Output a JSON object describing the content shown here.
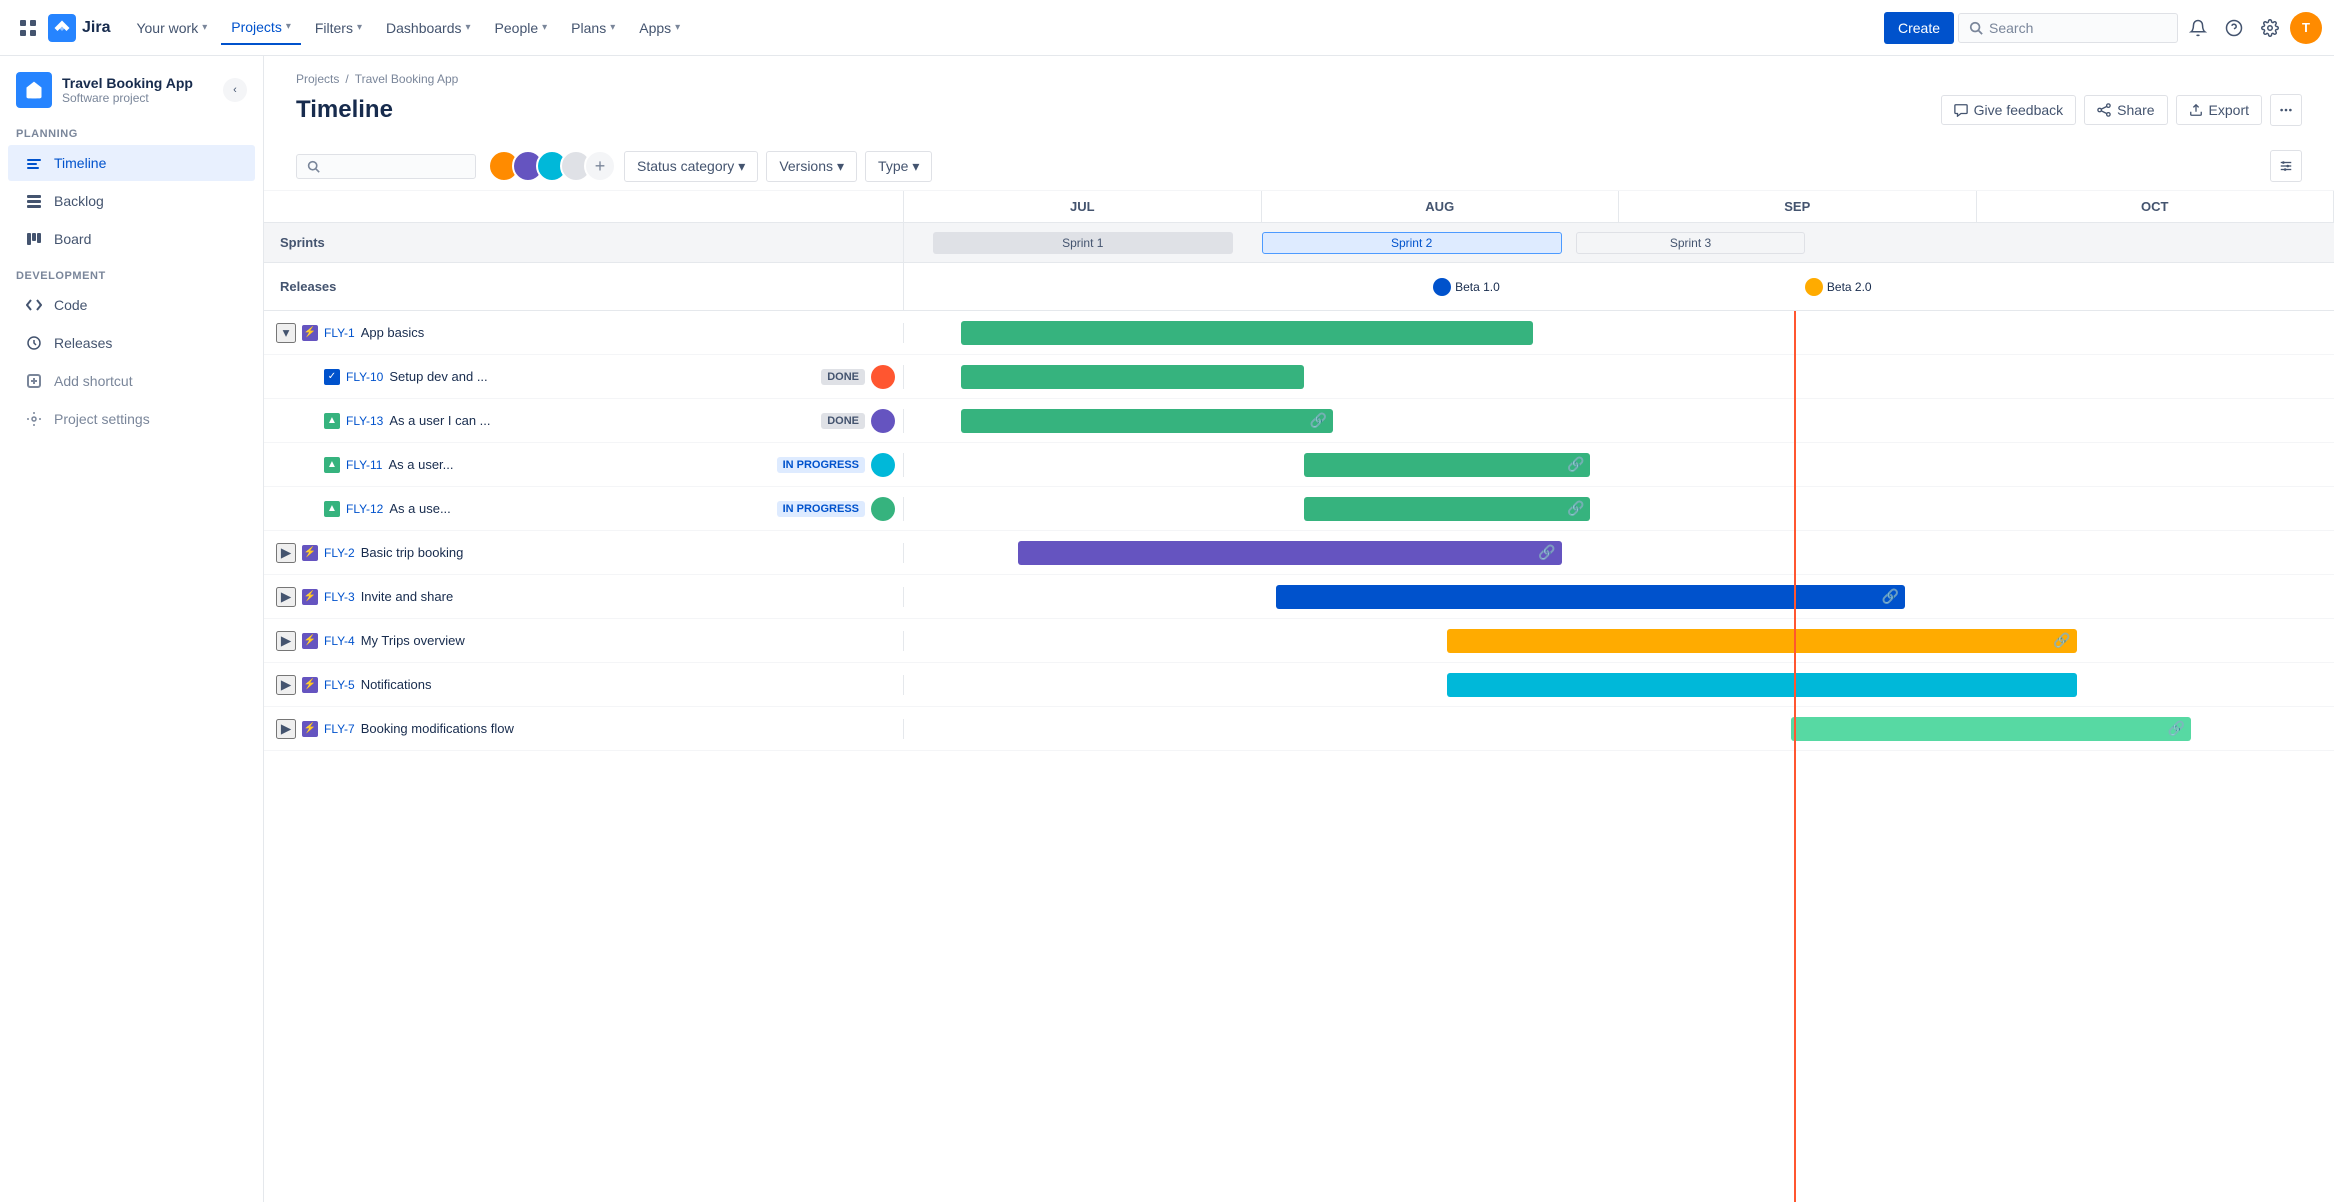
{
  "topnav": {
    "logo_text": "Jira",
    "nav_items": [
      {
        "label": "Your work",
        "active": false
      },
      {
        "label": "Projects",
        "active": true
      },
      {
        "label": "Filters",
        "active": false
      },
      {
        "label": "Dashboards",
        "active": false
      },
      {
        "label": "People",
        "active": false
      },
      {
        "label": "Plans",
        "active": false
      },
      {
        "label": "Apps",
        "active": false
      }
    ],
    "create_label": "Create",
    "search_placeholder": "Search"
  },
  "sidebar": {
    "project_name": "Travel Booking App",
    "project_type": "Software project",
    "planning_label": "PLANNING",
    "development_label": "DEVELOPMENT",
    "items": [
      {
        "label": "Timeline",
        "active": true
      },
      {
        "label": "Backlog",
        "active": false
      },
      {
        "label": "Board",
        "active": false
      },
      {
        "label": "Code",
        "active": false
      },
      {
        "label": "Releases",
        "active": false
      }
    ],
    "add_shortcut_label": "Add shortcut",
    "project_settings_label": "Project settings"
  },
  "breadcrumb": {
    "projects_label": "Projects",
    "project_name": "Travel Booking App"
  },
  "page": {
    "title": "Timeline",
    "give_feedback_label": "Give feedback",
    "share_label": "Share",
    "export_label": "Export"
  },
  "toolbar": {
    "status_category_label": "Status category",
    "versions_label": "Versions",
    "type_label": "Type"
  },
  "timeline": {
    "months": [
      "JUL",
      "AUG",
      "SEP",
      "OCT"
    ],
    "sprints_label": "Sprints",
    "releases_label": "Releases",
    "sprint1_label": "Sprint 1",
    "sprint2_label": "Sprint 2",
    "sprint3_label": "Sprint 3",
    "beta1_label": "Beta 1.0",
    "beta2_label": "Beta 2.0",
    "epics": [
      {
        "key": "FLY-1",
        "name": "App basics",
        "expanded": true,
        "bar_color": "bar-green",
        "bar_left": "4%",
        "bar_width": "38%",
        "children": [
          {
            "key": "FLY-10",
            "name": "Setup dev and ...",
            "status": "DONE",
            "bar_color": "bar-green",
            "bar_left": "4%",
            "bar_width": "22%"
          },
          {
            "key": "FLY-13",
            "name": "As a user I can ...",
            "status": "DONE",
            "bar_color": "bar-green",
            "bar_left": "4%",
            "bar_width": "23%"
          },
          {
            "key": "FLY-11",
            "name": "As a user...",
            "status": "IN PROGRESS",
            "bar_color": "bar-green",
            "bar_left": "26%",
            "bar_width": "20%"
          },
          {
            "key": "FLY-12",
            "name": "As a use...",
            "status": "IN PROGRESS",
            "bar_color": "bar-green",
            "bar_left": "26%",
            "bar_width": "20%"
          }
        ]
      },
      {
        "key": "FLY-2",
        "name": "Basic trip booking",
        "expanded": false,
        "bar_color": "bar-purple",
        "bar_left": "8%",
        "bar_width": "38%"
      },
      {
        "key": "FLY-3",
        "name": "Invite and share",
        "expanded": false,
        "bar_color": "bar-blue",
        "bar_left": "26%",
        "bar_width": "42%"
      },
      {
        "key": "FLY-4",
        "name": "My Trips overview",
        "expanded": false,
        "bar_color": "bar-yellow",
        "bar_left": "38%",
        "bar_width": "42%"
      },
      {
        "key": "FLY-5",
        "name": "Notifications",
        "expanded": false,
        "bar_color": "bar-teal",
        "bar_left": "38%",
        "bar_width": "42%"
      },
      {
        "key": "FLY-7",
        "name": "Booking modifications flow",
        "expanded": false,
        "bar_color": "bar-light-green",
        "bar_left": "62%",
        "bar_width": "28%"
      }
    ]
  }
}
